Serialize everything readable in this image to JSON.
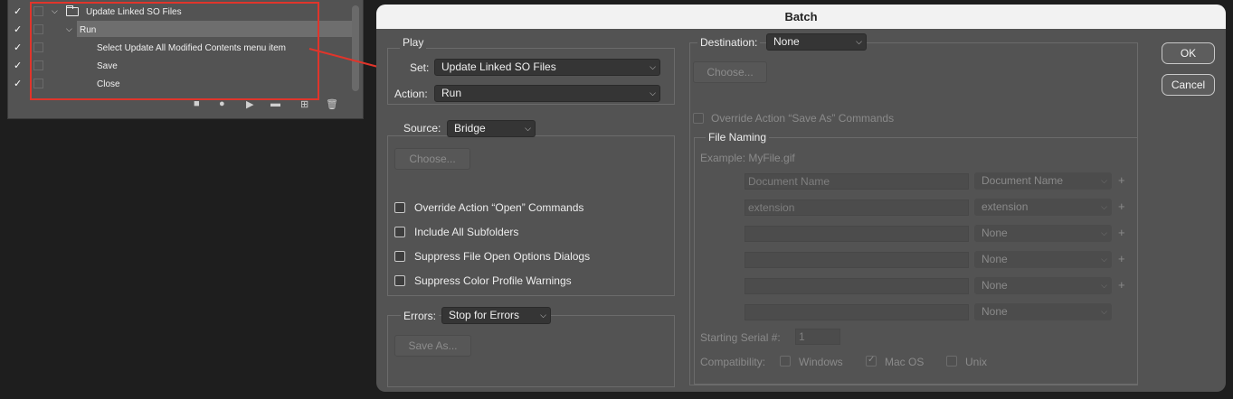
{
  "actions_panel": {
    "rows": [
      {
        "label": "Update Linked SO Files",
        "check": "✓",
        "toggle": "⌵",
        "kind": "set"
      },
      {
        "label": "Run",
        "check": "✓",
        "toggle": "⌵",
        "kind": "action"
      },
      {
        "label": "Select Update All Modified Contents menu item",
        "check": "✓",
        "kind": "step"
      },
      {
        "label": "Save",
        "check": "✓",
        "kind": "step"
      },
      {
        "label": "Close",
        "check": "✓",
        "kind": "step"
      }
    ],
    "toolbar": {
      "stop": "■",
      "record": "●",
      "play": "▶",
      "new_set": "▬",
      "new_action": "⊞",
      "delete": "🗑"
    }
  },
  "highlight_color": "#e0352b",
  "batch": {
    "title": "Batch",
    "play": {
      "group_title": "Play",
      "set_label": "Set:",
      "set_value": "Update Linked SO Files",
      "action_label": "Action:",
      "action_value": "Run"
    },
    "source": {
      "label": "Source:",
      "value": "Bridge",
      "choose_label": "Choose...",
      "options": [
        {
          "label": "Override Action “Open” Commands",
          "checked": false
        },
        {
          "label": "Include All Subfolders",
          "checked": false
        },
        {
          "label": "Suppress File Open Options Dialogs",
          "checked": false
        },
        {
          "label": "Suppress Color Profile Warnings",
          "checked": false
        }
      ]
    },
    "errors": {
      "label": "Errors:",
      "value": "Stop for Errors",
      "save_as_label": "Save As..."
    },
    "destination": {
      "label": "Destination:",
      "value": "None",
      "choose_label": "Choose...",
      "override_label": "Override Action “Save As” Commands",
      "file_naming": {
        "title": "File Naming",
        "example": "Example: MyFile.gif",
        "rows": [
          {
            "field": "Document Name",
            "select": "Document Name",
            "plus": "+"
          },
          {
            "field": "extension",
            "select": "extension",
            "plus": "+"
          },
          {
            "field": "",
            "select": "None",
            "plus": "+"
          },
          {
            "field": "",
            "select": "None",
            "plus": "+"
          },
          {
            "field": "",
            "select": "None",
            "plus": "+"
          },
          {
            "field": "",
            "select": "None",
            "plus": ""
          }
        ],
        "serial_label": "Starting Serial #:",
        "serial_value": "1",
        "compat_label": "Compatibility:",
        "compat": [
          {
            "label": "Windows",
            "checked": false
          },
          {
            "label": "Mac OS",
            "checked": true
          },
          {
            "label": "Unix",
            "checked": false
          }
        ]
      }
    },
    "ok_label": "OK",
    "cancel_label": "Cancel"
  }
}
